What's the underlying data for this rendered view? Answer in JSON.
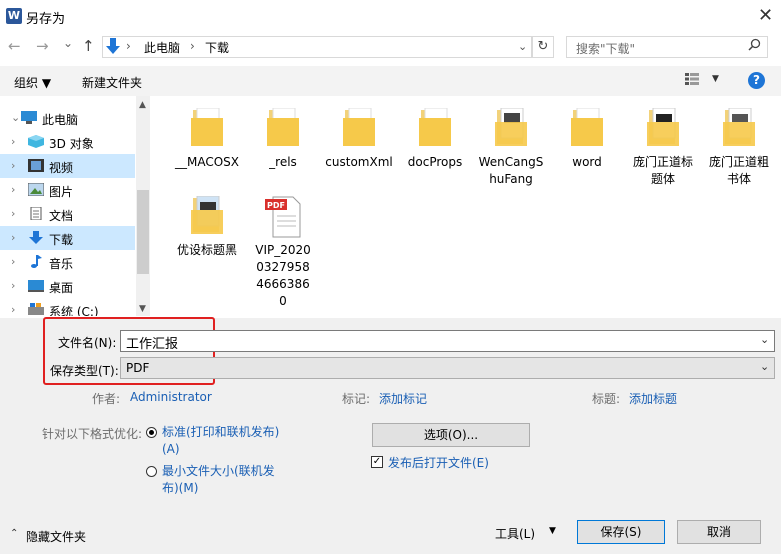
{
  "window": {
    "title": "另存为",
    "app_icon": "W",
    "close": "✕"
  },
  "nav": {
    "back": "←",
    "forward": "→",
    "recent": "⌄",
    "up": "↑",
    "breadcrumb": [
      "此电脑",
      "下载"
    ],
    "refresh": "↻",
    "search_placeholder": "搜索\"下载\""
  },
  "toolbar": {
    "organize": "组织 ▼",
    "new_folder": "新建文件夹",
    "help": "?"
  },
  "sidebar": {
    "items": [
      {
        "label": "此电脑",
        "icon": "pc-icon",
        "expanded": true
      },
      {
        "label": "3D 对象",
        "icon": "3d-objects-icon"
      },
      {
        "label": "视频",
        "icon": "video-icon",
        "hover": true
      },
      {
        "label": "图片",
        "icon": "pictures-icon"
      },
      {
        "label": "文档",
        "icon": "documents-icon"
      },
      {
        "label": "下载",
        "icon": "download-icon",
        "selected": true
      },
      {
        "label": "音乐",
        "icon": "music-icon"
      },
      {
        "label": "桌面",
        "icon": "desktop-icon"
      },
      {
        "label": "系统 (C:)",
        "icon": "drive-icon"
      }
    ]
  },
  "files": [
    {
      "name": "__MACOSX",
      "type": "folder"
    },
    {
      "name": "_rels",
      "type": "folder"
    },
    {
      "name": "customXml",
      "type": "folder"
    },
    {
      "name": "docProps",
      "type": "folder"
    },
    {
      "name": "WenCangShuFang",
      "type": "folder-preview"
    },
    {
      "name": "word",
      "type": "folder"
    },
    {
      "name": "庞门正道标题体",
      "type": "folder-preview"
    },
    {
      "name": "庞门正道粗书体",
      "type": "folder-preview"
    },
    {
      "name": "优设标题黑",
      "type": "folder-preview"
    },
    {
      "name": "VIP_2020032795846663860",
      "type": "pdf",
      "badge": "PDF"
    }
  ],
  "form": {
    "filename_label": "文件名(N):",
    "filename_value": "工作汇报",
    "filetype_label": "保存类型(T):",
    "filetype_value": "PDF",
    "author_label": "作者:",
    "author_value": "Administrator",
    "tags_label": "标记:",
    "tags_value": "添加标记",
    "title_label": "标题:",
    "title_value": "添加标题",
    "optimize_label": "针对以下格式优化:",
    "option_standard": "标准(打印和联机发布)(A)",
    "option_minimum": "最小文件大小(联机发布)(M)",
    "options_button": "选项(O)...",
    "open_after": "发布后打开文件(E)",
    "hide_folders": "隐藏文件夹",
    "tools": "工具(L)",
    "save": "保存(S)",
    "cancel": "取消"
  }
}
